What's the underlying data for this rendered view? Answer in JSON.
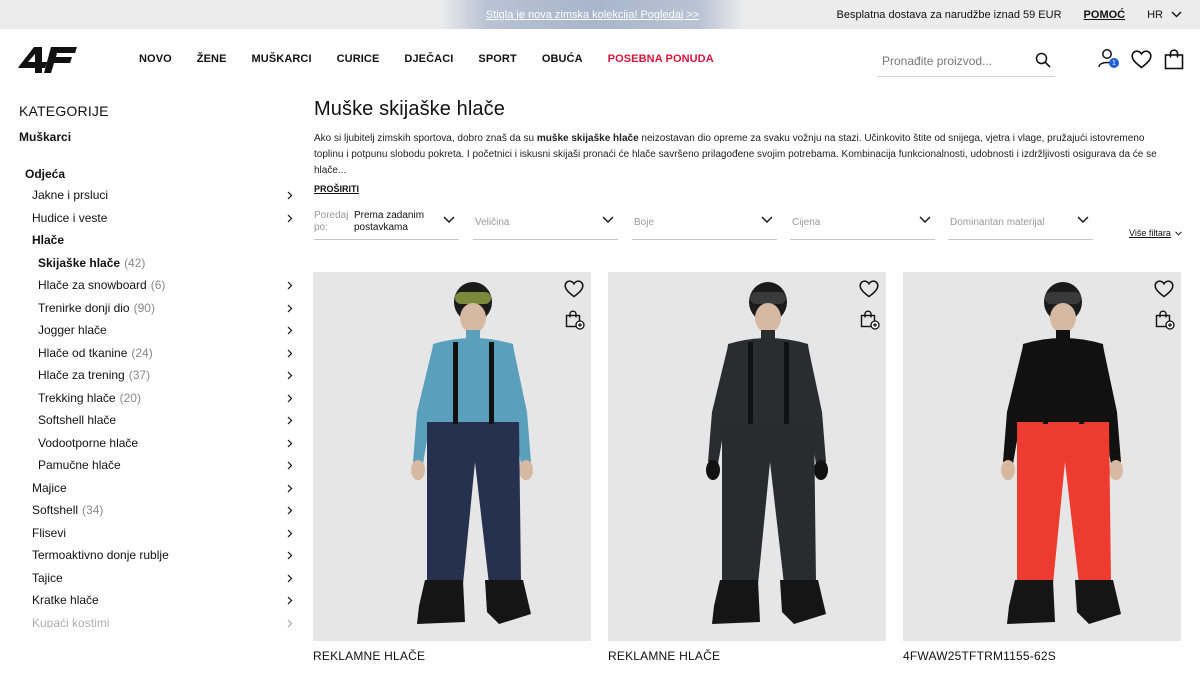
{
  "topbar": {
    "promo": "Stigla je nova zimska kolekcija! Pogledaj >>",
    "shipping": "Besplatna dostava za narudžbe iznad 59 EUR",
    "help": "POMOĆ",
    "lang": "HR"
  },
  "header": {
    "nav": [
      "NOVO",
      "ŽENE",
      "MUŠKARCI",
      "CURICE",
      "DJEČACI",
      "SPORT",
      "OBUĆA"
    ],
    "special": "POSEBNA PONUDA",
    "search_placeholder": "Pronađite proizvod...",
    "cart_badge": "1",
    "accent": "#d6163e",
    "badge_color": "#1f5fd6"
  },
  "sidebar": {
    "title": "KATEGORIJE",
    "gender": "Muškarci",
    "group": "Odjeća",
    "items": [
      {
        "label": "Jakne i prsluci",
        "count": "",
        "level": 1
      },
      {
        "label": "Hudice i veste",
        "count": "",
        "level": 1
      },
      {
        "label": "Hlače",
        "count": "",
        "level": 1,
        "open": true
      },
      {
        "label": "Skijaške hlače",
        "count": "(42)",
        "level": 2,
        "active": true
      },
      {
        "label": "Hlače za snowboard",
        "count": "(6)",
        "level": 2
      },
      {
        "label": "Trenirke donji dio",
        "count": "(90)",
        "level": 2
      },
      {
        "label": "Jogger hlače",
        "count": "",
        "level": 2
      },
      {
        "label": "Hlače od tkanine",
        "count": "(24)",
        "level": 2
      },
      {
        "label": "Hlače za trening",
        "count": "(37)",
        "level": 2
      },
      {
        "label": "Trekking hlače",
        "count": "(20)",
        "level": 2
      },
      {
        "label": "Softshell hlače",
        "count": "",
        "level": 2
      },
      {
        "label": "Vodootporne hlače",
        "count": "",
        "level": 2
      },
      {
        "label": "Pamučne hlače",
        "count": "",
        "level": 2
      },
      {
        "label": "Majice",
        "count": "",
        "level": 1
      },
      {
        "label": "Softshell",
        "count": "(34)",
        "level": 1
      },
      {
        "label": "Flisevi",
        "count": "",
        "level": 1
      },
      {
        "label": "Termoaktivno donje rublje",
        "count": "",
        "level": 1
      },
      {
        "label": "Tajice",
        "count": "",
        "level": 1
      },
      {
        "label": "Kratke hlače",
        "count": "",
        "level": 1
      },
      {
        "label": "Kupaći kostimi",
        "count": "",
        "level": 1,
        "fade": true
      }
    ]
  },
  "main": {
    "title": "Muške skijaške hlače",
    "desc_pre": "Ako si ljubitelj zimskih sportova, dobro znaš da su ",
    "desc_bold": "muške skijaške hlače",
    "desc_post": " neizostavan dio opreme za svaku vožnju na stazi. Učinkovito štite od snijega, vjetra i vlage, pružajući istovremeno toplinu i potpunu slobodu pokreta. I početnici i iskusni skijaši pronaći će hlače savršeno prilagođene svojim potrebama. Kombinacija funkcionalnosti, udobnosti i izdržljivosti osigurava da će se hlače...",
    "expand": "PROŠIRITI"
  },
  "filters": {
    "sort_label": "Poredaj po:",
    "sort_value": "Prema zadanim postavkama",
    "size": "Veličina",
    "colors": "Boje",
    "price": "Cijena",
    "material": "Dominantan materijal",
    "more": "Više filtara"
  },
  "products": [
    {
      "title": "REKLAMNE HLAČE",
      "top_color": "#5aa0bd",
      "pants_color": "#26314f"
    },
    {
      "title": "REKLAMNE HLAČE",
      "top_color": "#2b2c30",
      "pants_color": "#2a2b2f"
    },
    {
      "title": "4FWAW25TFTRM1155-62S",
      "top_color": "#111111",
      "pants_color": "#ee3b2f"
    }
  ]
}
